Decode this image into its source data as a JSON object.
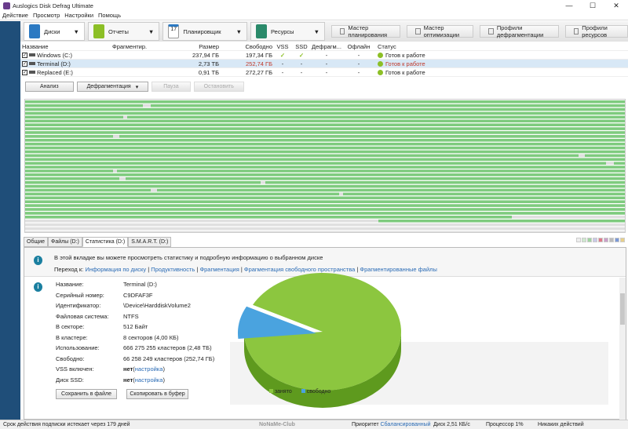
{
  "window": {
    "title": "Auslogics Disk Defrag Ultimate",
    "minimize": "—",
    "maximize": "☐",
    "close": "✕"
  },
  "menu": [
    "Действие",
    "Просмотр",
    "Настройки",
    "Помощь"
  ],
  "toolbar": {
    "tabs": [
      {
        "label": "Диски",
        "color": "#2b79c2"
      },
      {
        "label": "Отчеты",
        "color": "#8cbf26"
      },
      {
        "label": "Планировщик",
        "color": "#e8e8e8"
      },
      {
        "label": "Ресурсы",
        "color": "#2a8a6a"
      }
    ],
    "buttons": [
      "Мастер планирования",
      "Мастер оптимизации",
      "Профили дефрагментации",
      "Профили ресурсов"
    ]
  },
  "disk_table": {
    "headers": [
      "Название",
      "Фрагментир.",
      "Размер",
      "Свободно",
      "VSS",
      "SSD",
      "Дефрагм...",
      "Офлайн",
      "Статус"
    ],
    "rows": [
      {
        "name": "Windows (C:)",
        "frag": "",
        "size": "237,94 ГБ",
        "free": "197,34 ГБ",
        "vss": "✓",
        "ssd": "✓",
        "defrag": "-",
        "offline": "-",
        "status": "Готов к работе",
        "selected": false
      },
      {
        "name": "Terminal (D:)",
        "frag": "",
        "size": "2,73 ТБ",
        "free": "252,74 ГБ",
        "vss": "-",
        "ssd": "-",
        "defrag": "-",
        "offline": "-",
        "status": "Готов к работе",
        "selected": true
      },
      {
        "name": "Replaced (E:)",
        "frag": "",
        "size": "0,91 ТБ",
        "free": "272,27 ГБ",
        "vss": "-",
        "ssd": "-",
        "defrag": "-",
        "offline": "-",
        "status": "Готов к работе",
        "selected": false
      }
    ]
  },
  "actions": {
    "analyze": "Анализ",
    "defrag": "Дефрагментация",
    "pause": "Пауза",
    "stop": "Остановить"
  },
  "colors": {
    "used": "#7ecb7e",
    "free": "#e0e0e0",
    "pie_used": "#8cc63f",
    "pie_free": "#4aa3df",
    "accent": "#2a6bb5"
  },
  "tabs": [
    "Общие",
    "Файлы (D:)",
    "Статистика (D:)",
    "S.M.A.R.T. (D:)"
  ],
  "info": {
    "text": "В этой вкладке вы можете просмотреть статистику и подробную информацию о выбранном диске",
    "goto": "Переход к:",
    "links": [
      "Информация по диску",
      "Продуктивность",
      "Фрагментация",
      "Фрагментация свободного пространства",
      "Фрагментированные файлы"
    ]
  },
  "props": [
    {
      "k": "Название:",
      "v": "Terminal (D:)"
    },
    {
      "k": "Серийный номер:",
      "v": "C9DFAF3F"
    },
    {
      "k": "Идентификатор:",
      "v": "\\Device\\HarddiskVolume2"
    },
    {
      "k": "Файловая система:",
      "v": "NTFS"
    },
    {
      "k": "В секторе:",
      "v": "512 Байт"
    },
    {
      "k": "В кластере:",
      "v": "8 секторов (4,00 КБ)"
    },
    {
      "k": "Использование:",
      "v": "666 275 255 кластеров (2,48 ТБ)"
    },
    {
      "k": "Свободно:",
      "v": "66 258 249 кластеров (252,74 ГБ)"
    },
    {
      "k": "VSS включен:",
      "v": "нет",
      "link": "настройка"
    },
    {
      "k": "Диск SSD:",
      "v": "нет",
      "link": "настройка"
    }
  ],
  "buttons": {
    "save": "Сохранить в файле",
    "copy": "Скопировать в буфер"
  },
  "chart_data": {
    "type": "pie",
    "labels": [
      "занято",
      "свободно"
    ],
    "values": [
      2.48,
      0.2468
    ],
    "units": "ТБ"
  },
  "statusbar": {
    "subscription": "Срок действия подписки истекает через 179 дней",
    "priority_label": "Приоритет",
    "priority": "Сбалансированный",
    "disk": "Диск 2,51 КБ/с",
    "cpu": "Процессор 1%",
    "actions": "Никаких действий"
  },
  "watermark": "NoNaMe-Club"
}
